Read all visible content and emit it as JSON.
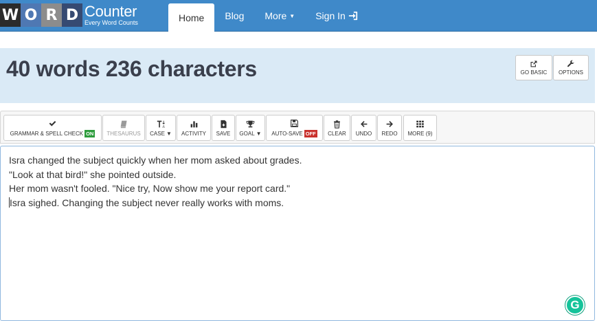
{
  "logo": {
    "letters": [
      "W",
      "O",
      "R",
      "D"
    ],
    "name": "Counter",
    "tagline": "Every Word Counts"
  },
  "nav": {
    "home": "Home",
    "blog": "Blog",
    "more": "More",
    "signin": "Sign In"
  },
  "header": {
    "counts": "40 words 236 characters",
    "go_basic": "GO BASIC",
    "options": "OPTIONS"
  },
  "toolbar": {
    "grammar": "GRAMMAR & SPELL CHECK",
    "grammar_state": "ON",
    "thesaurus": "THESAURUS",
    "case": "CASE",
    "activity": "ACTIVITY",
    "save": "SAVE",
    "goal": "GOAL",
    "autosave": "AUTO-SAVE",
    "autosave_state": "OFF",
    "clear": "CLEAR",
    "undo": "UNDO",
    "redo": "REDO",
    "more": "MORE (9)"
  },
  "editor": {
    "lines": [
      "Isra changed the subject quickly when her mom asked about grades.",
      "\"Look at that bird!\" she pointed outside.",
      "Her mom wasn't fooled. \"Nice try, Now show me your report card.\"",
      "Isra sighed. Changing the subject never really works with moms."
    ]
  },
  "colors": {
    "navbar": "#3f89c9",
    "header_band": "#daeaf6",
    "on_badge": "#2d9c3c",
    "off_badge": "#c9302c",
    "grammarly": "#15c39a"
  },
  "icons": [
    "check-icon",
    "book-icon",
    "text-case-icon",
    "bar-chart-icon",
    "save-file-icon",
    "trophy-icon",
    "floppy-icon",
    "trash-icon",
    "arrow-left-icon",
    "arrow-right-icon",
    "grid-icon",
    "external-link-icon",
    "wrench-icon",
    "sign-in-icon",
    "grammarly-icon"
  ]
}
